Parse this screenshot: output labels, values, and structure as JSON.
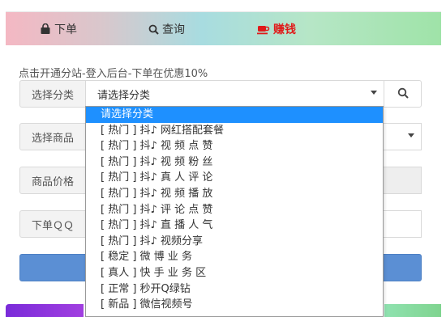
{
  "tabs": [
    {
      "label": "下单",
      "icon": "shopping-bag-icon"
    },
    {
      "label": "查询",
      "icon": "search-icon"
    },
    {
      "label": "赚钱",
      "icon": "coffee-cup-icon",
      "color": "#e01a1a"
    }
  ],
  "notice": "点击开通分站-登入后台-下单在优惠10%",
  "form": {
    "category_label": "选择分类",
    "category_value": "请选择分类",
    "product_label": "选择商品",
    "price_label": "商品价格",
    "qq_label": "下单ＱＱ"
  },
  "dropdown": {
    "options": [
      "请选择分类",
      "[ 热门 ] 抖♪ 网红搭配套餐",
      "[ 热门 ] 抖♪ 视 频 点 赞",
      "[ 热门 ] 抖♪ 视 频 粉 丝",
      "[ 热门 ] 抖♪ 真 人 评 论",
      "[ 热门 ] 抖♪ 视 频 播 放",
      "[ 热门 ] 抖♪ 评 论 点 赞",
      "[ 热门 ] 抖♪ 直 播 人 气",
      "[ 热门 ] 抖♪ 视频分享",
      "[ 稳定 ] 微 博 业 务",
      "[ 真人 ] 快 手 业 务 区",
      "[ 正常 ] 秒开Q绿钻",
      "[ 新品 ] 微信视频号"
    ],
    "selected_index": 0
  },
  "colors": {
    "accent": "#1e90ff",
    "submit": "#5b8fd4",
    "earn": "#e01a1a"
  }
}
